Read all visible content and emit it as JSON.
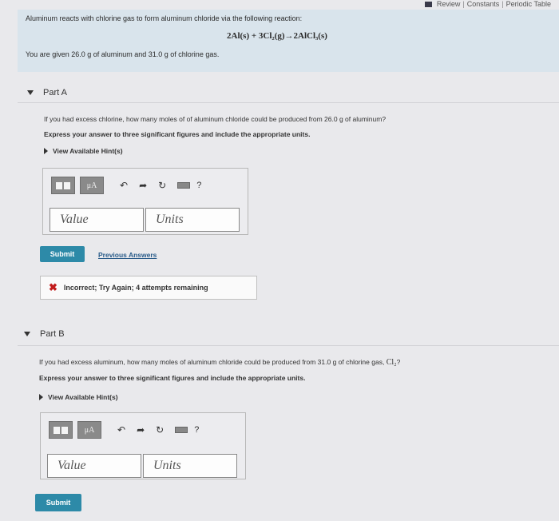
{
  "topbar": {
    "review": "Review",
    "constants": "Constants",
    "periodic_table": "Periodic Table",
    "sep": "|"
  },
  "intro": {
    "line1": "Aluminum reacts with chlorine gas to form aluminum chloride via the following reaction:",
    "equation": "2Al(s) + 3Cl₂(g)→2AlCl₃(s)",
    "line2": "You are given 26.0 g of aluminum and 31.0 g of chlorine gas."
  },
  "part_a": {
    "title": "Part A",
    "question": "If you had excess chlorine, how many moles of of aluminum chloride could be produced from 26.0 g of aluminum?",
    "instructions": "Express your answer to three significant figures and include the appropriate units.",
    "hint_label": "View Available Hint(s)",
    "value_placeholder": "Value",
    "units_placeholder": "Units",
    "submit_label": "Submit",
    "previous_answers": "Previous Answers",
    "feedback": "Incorrect; Try Again; 4 attempts remaining"
  },
  "part_b": {
    "title": "Part B",
    "question_pre": "If you had excess aluminum, how many moles of aluminum chloride could be produced from 31.0 g of chlorine gas,",
    "question_chem": "Cl₂",
    "question_post": "?",
    "instructions": "Express your answer to three significant figures and include the appropriate units.",
    "hint_label": "View Available Hint(s)",
    "value_placeholder": "Value",
    "units_placeholder": "Units",
    "submit_label": "Submit"
  },
  "toolbar": {
    "mu_label": "μA",
    "help": "?"
  },
  "colors": {
    "submit": "#2d8aa8",
    "incorrect": "#c21b1b",
    "intro_bg": "#d9e4ec"
  }
}
